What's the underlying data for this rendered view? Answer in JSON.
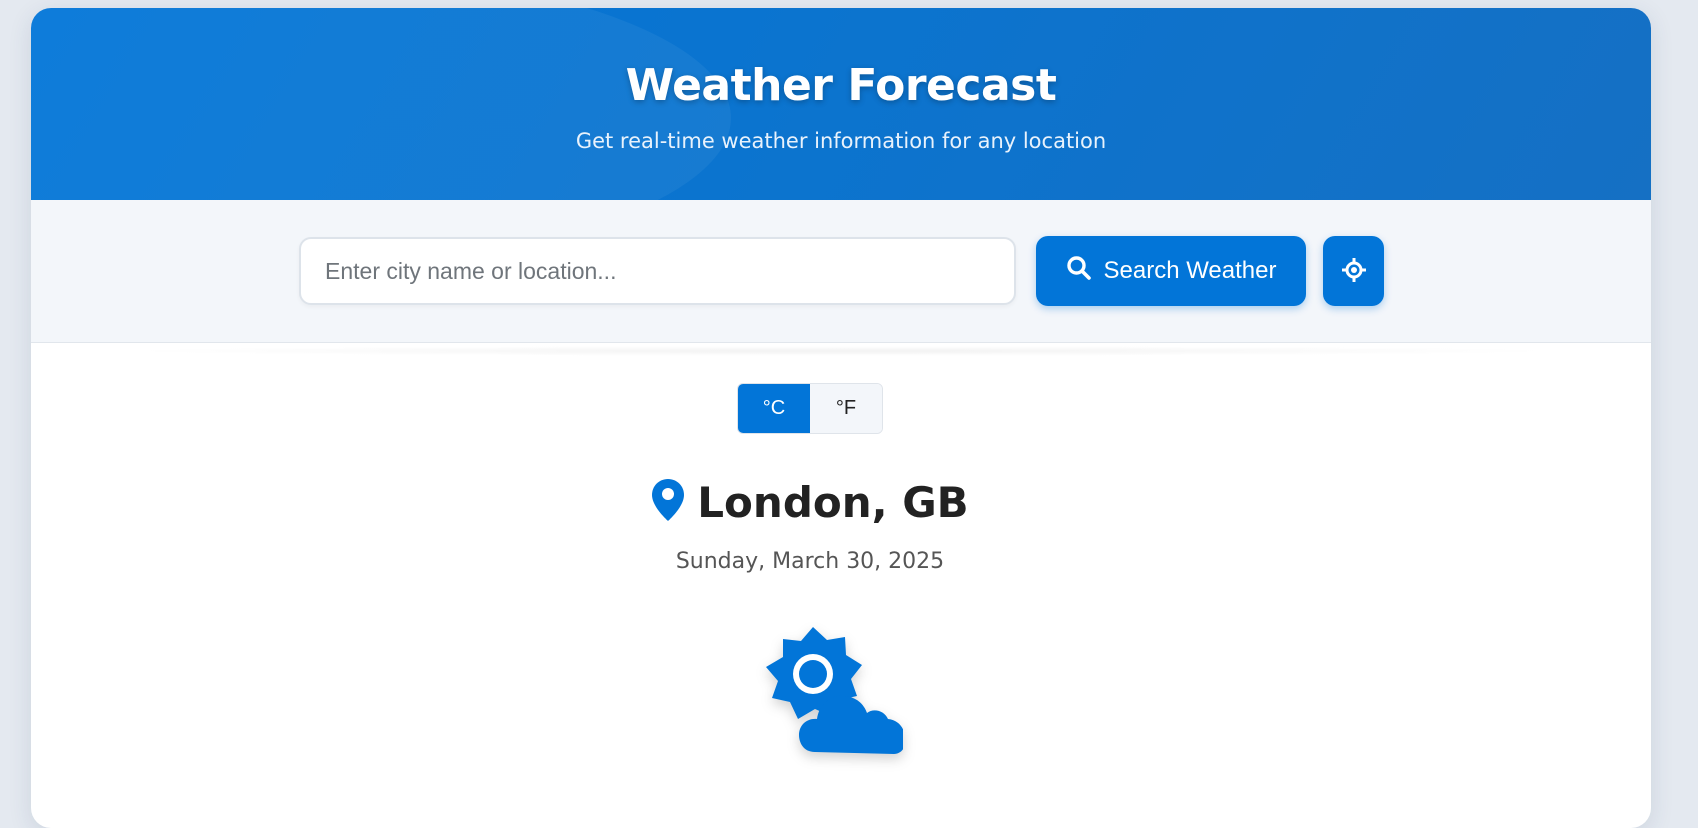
{
  "header": {
    "title": "Weather Forecast",
    "subtitle": "Get real-time weather information for any location"
  },
  "search": {
    "placeholder": "Enter city name or location...",
    "value": "",
    "button_label": "Search Weather",
    "search_icon": "search-icon",
    "locate_icon": "crosshair-icon"
  },
  "units": {
    "celsius_label": "°C",
    "fahrenheit_label": "°F",
    "selected": "°C"
  },
  "weather": {
    "location": "London, GB",
    "location_icon": "map-pin-icon",
    "date": "Sunday, March 30, 2025",
    "condition_icon": "partly-cloudy-icon"
  },
  "colors": {
    "accent": "#0275d8",
    "header_gradient_end": "#1570c4",
    "background": "#e4e9f0"
  }
}
